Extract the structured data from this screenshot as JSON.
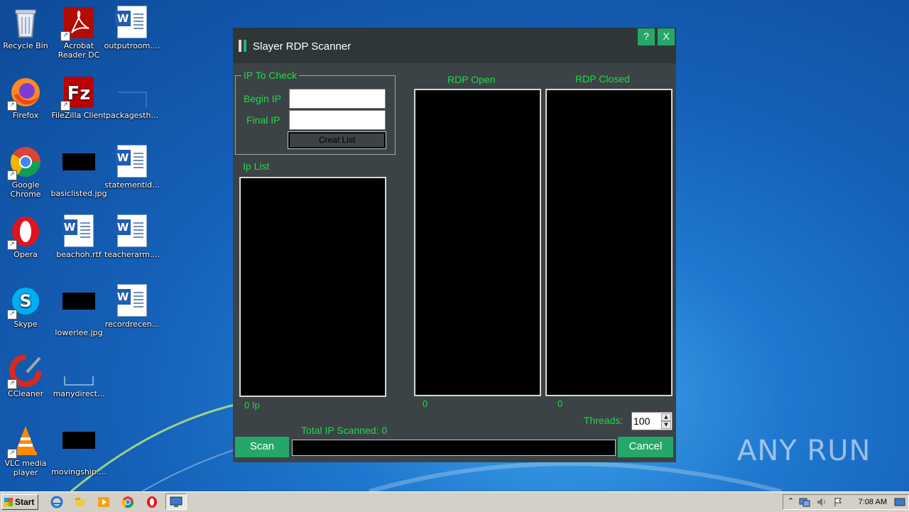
{
  "desktop": {
    "icons": [
      {
        "label": "Recycle Bin",
        "icon": "recycle-bin-icon"
      },
      {
        "label": "Acrobat Reader DC",
        "icon": "acrobat-icon"
      },
      {
        "label": "outputroom....",
        "icon": "word-doc-icon"
      },
      {
        "label": "Firefox",
        "icon": "firefox-icon"
      },
      {
        "label": "FileZilla Client",
        "icon": "filezilla-icon"
      },
      {
        "label": "packagesth...",
        "icon": "file-icon"
      },
      {
        "label": "Google Chrome",
        "icon": "chrome-icon"
      },
      {
        "label": "basiclisted.jpg",
        "icon": "image-file-icon"
      },
      {
        "label": "statementid...",
        "icon": "word-doc-icon"
      },
      {
        "label": "Opera",
        "icon": "opera-icon"
      },
      {
        "label": "beachoh.rtf",
        "icon": "word-doc-icon"
      },
      {
        "label": "teacherarm....",
        "icon": "word-doc-icon"
      },
      {
        "label": "Skype",
        "icon": "skype-icon"
      },
      {
        "label": "lowerlee.jpg",
        "icon": "image-file-icon"
      },
      {
        "label": "recordrecen...",
        "icon": "word-doc-icon"
      },
      {
        "label": "CCleaner",
        "icon": "ccleaner-icon"
      },
      {
        "label": "manydirect...",
        "icon": "file-icon"
      },
      {
        "label": "VLC media player",
        "icon": "vlc-icon"
      },
      {
        "label": "movingship....",
        "icon": "image-file-icon"
      }
    ]
  },
  "window": {
    "title": "Slayer RDP Scanner",
    "help_label": "?",
    "close_label": "X",
    "ip_group_label": "IP To Check",
    "begin_ip_label": "Begin IP",
    "begin_ip_value": "",
    "final_ip_label": "Final IP",
    "final_ip_value": "",
    "creat_list_label": "Creat List",
    "ip_list_label": "Ip List",
    "ip_count": "0 Ip",
    "rdp_open_label": "RDP Open",
    "rdp_open_count": "0",
    "rdp_closed_label": "RDP Closed",
    "rdp_closed_count": "0",
    "threads_label": "Threads:",
    "threads_value": "100",
    "total_scanned": "Total IP Scanned: 0",
    "scan_label": "Scan",
    "cancel_label": "Cancel",
    "progress": 0
  },
  "taskbar": {
    "start_label": "Start",
    "quick_launch": [
      "ie-icon",
      "explorer-icon",
      "media-player-icon",
      "chrome-icon",
      "opera-icon",
      "rdp-app-icon"
    ],
    "clock": "7:08 AM"
  },
  "watermark": "ANY RUN",
  "colors": {
    "accent_green": "#25a76a",
    "label_green": "#22d94a",
    "window_bg": "#3b4346",
    "desktop_blue": "#1f78cf"
  }
}
